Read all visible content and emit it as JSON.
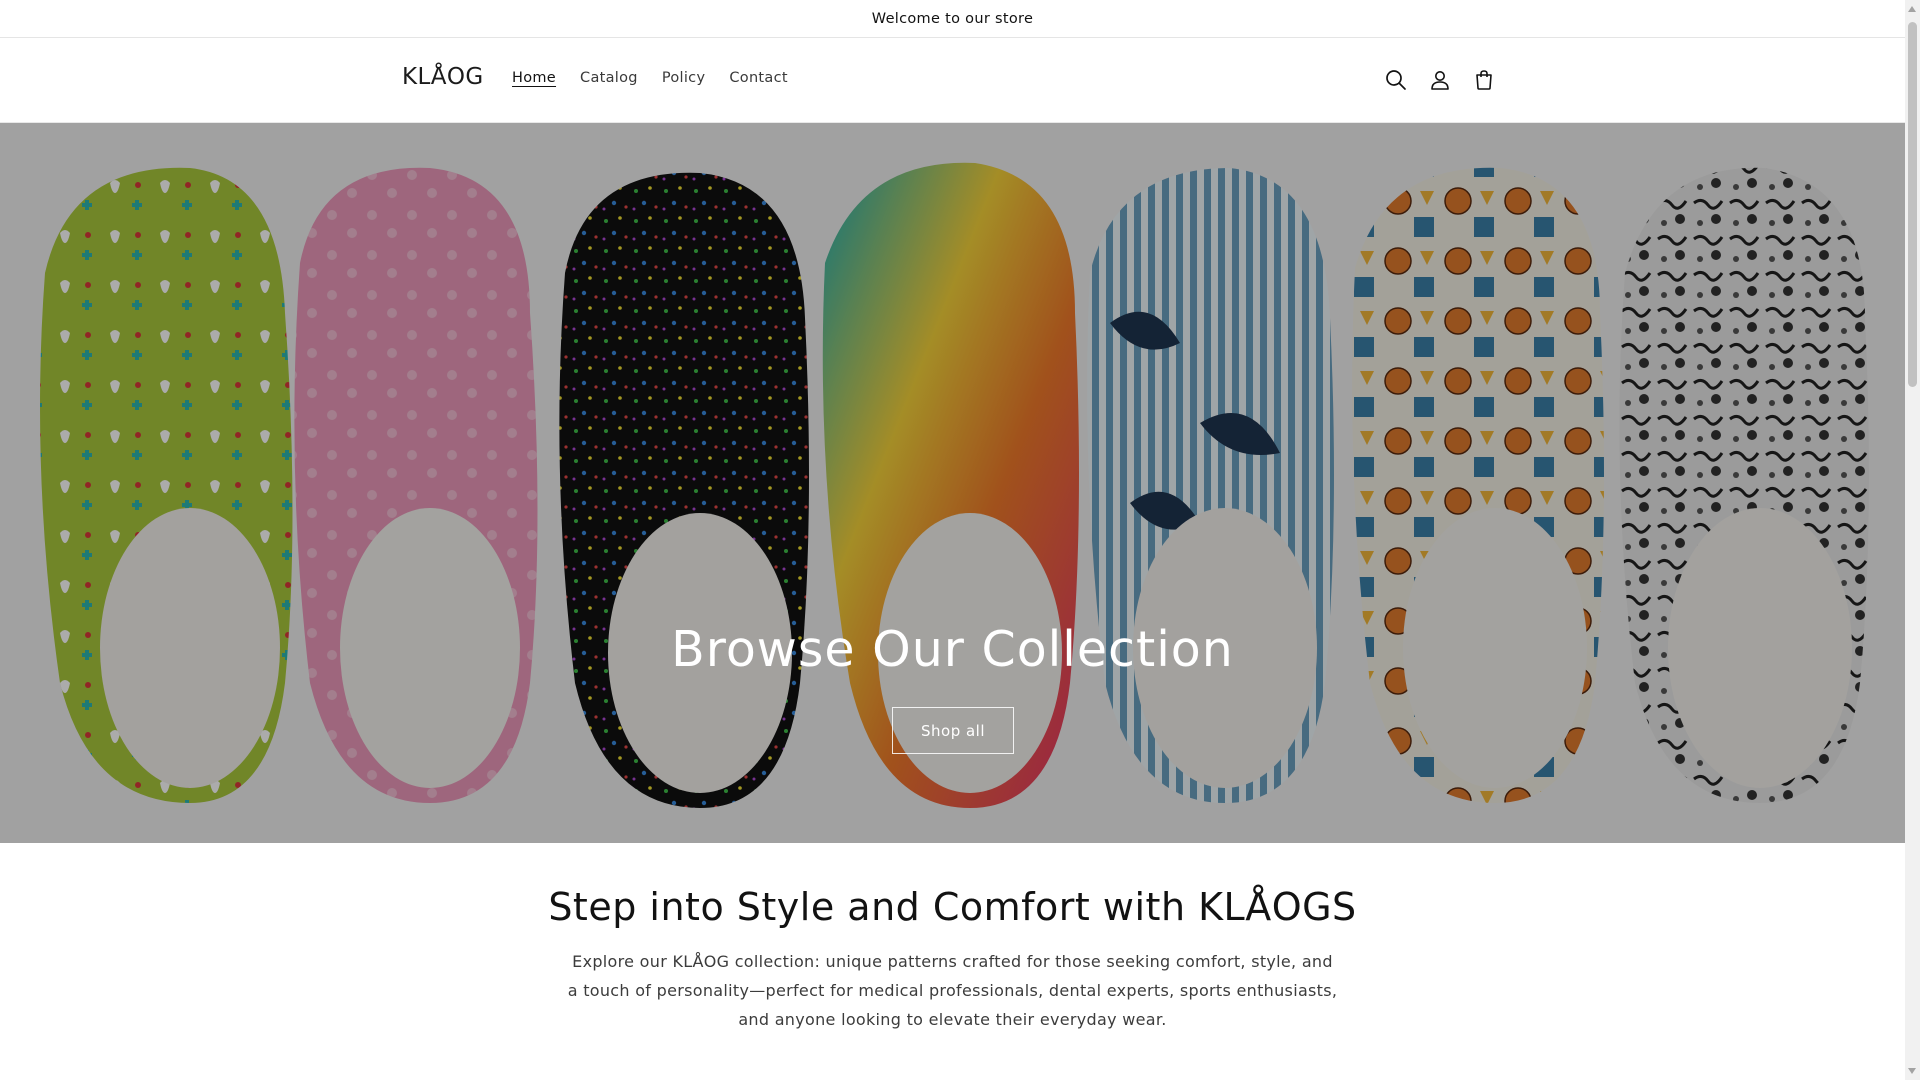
{
  "announcement": {
    "text": "Welcome to our store"
  },
  "header": {
    "logo": "KLÅOG",
    "nav": [
      {
        "label": "Home",
        "active": true
      },
      {
        "label": "Catalog",
        "active": false
      },
      {
        "label": "Policy",
        "active": false
      },
      {
        "label": "Contact",
        "active": false
      }
    ],
    "icons": [
      "search-icon",
      "account-icon",
      "cart-icon"
    ]
  },
  "hero": {
    "title": "Browse Our Collection",
    "button_label": "Shop all",
    "image_alt": "Seven patterned clogs: green dental, pink, black splatter, tie-dye, striped tropical, basketball, black & white marble",
    "clog_colors": [
      "#a7c43c",
      "#e992b7",
      "#1a1a1a",
      "#2fb5a4",
      "#5b8fb0",
      "#e5a13a",
      "#cfcfcf"
    ]
  },
  "intro": {
    "heading": "Step into Style and Comfort with KLÅOGS",
    "body": "Explore our KLÅOG collection: unique patterns crafted for those seeking comfort, style, and a touch of personality—perfect for medical professionals, dental experts, sports enthusiasts, and anyone looking to elevate their everyday wear."
  }
}
